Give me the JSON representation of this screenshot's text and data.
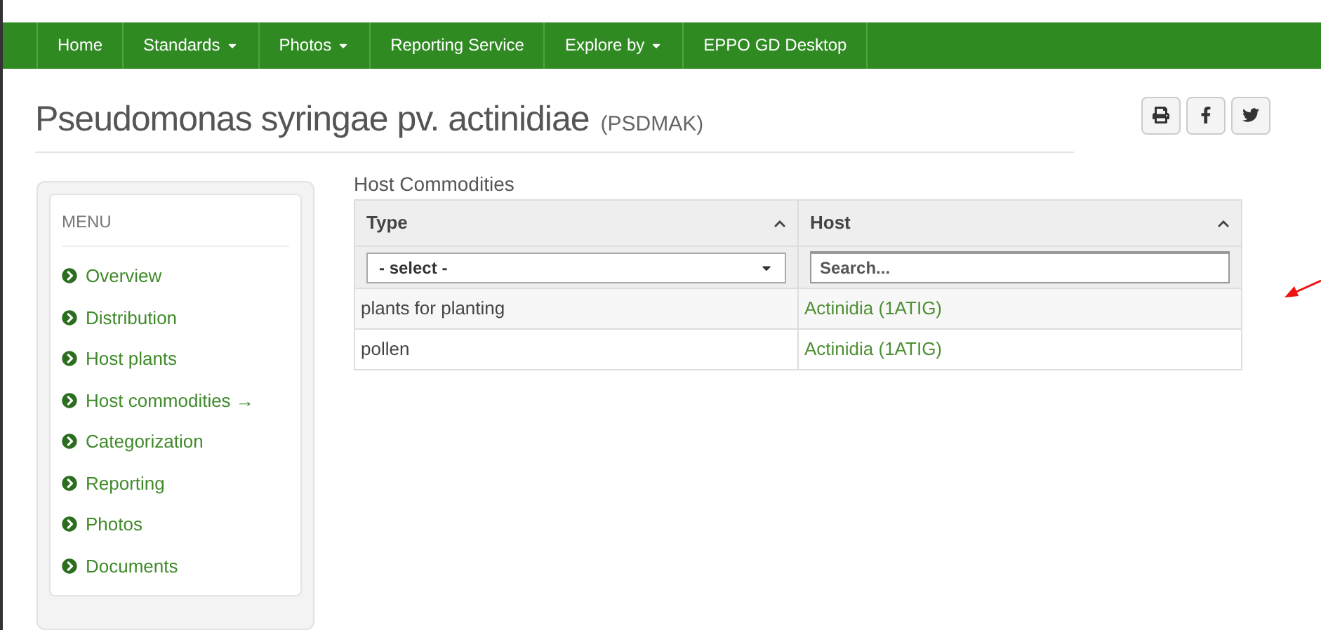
{
  "nav": [
    {
      "label": "Home",
      "dropdown": false
    },
    {
      "label": "Standards",
      "dropdown": true
    },
    {
      "label": "Photos",
      "dropdown": true
    },
    {
      "label": "Reporting Service",
      "dropdown": false
    },
    {
      "label": "Explore by",
      "dropdown": true
    },
    {
      "label": "EPPO GD Desktop",
      "dropdown": false
    }
  ],
  "title": "Pseudomonas syringae pv. actinidiae",
  "code": "(PSDMAK)",
  "share_buttons": [
    {
      "kind": "print"
    },
    {
      "kind": "facebook"
    },
    {
      "kind": "twitter"
    }
  ],
  "menu": {
    "heading": "MENU",
    "items": [
      "Overview",
      "Distribution",
      "Host plants",
      "Host commodities →",
      "Categorization",
      "Reporting",
      "Photos",
      "Documents"
    ]
  },
  "section_title": "Host Commodities",
  "table": {
    "columns": [
      "Type",
      "Host"
    ],
    "type_filter": "- select -",
    "host_filter_placeholder": "Search...",
    "rows": [
      [
        "plants for planting",
        "Actinidia (1ATIG)"
      ],
      [
        "pollen",
        "Actinidia (1ATIG)"
      ]
    ]
  }
}
